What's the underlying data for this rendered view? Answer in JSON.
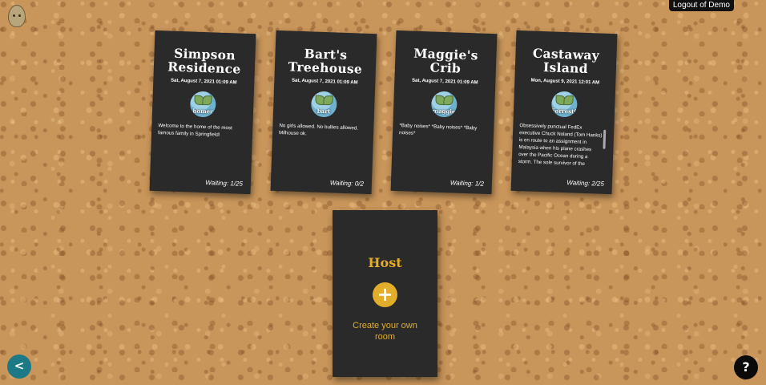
{
  "logo": {
    "icon": "potato-logo-icon"
  },
  "header": {
    "logout_label": "Logout of Demo"
  },
  "rooms": [
    {
      "title": "Simpson Residence",
      "date": "Sat, August 7, 2021 01:09 AM",
      "host": "homer",
      "description": "Welcome to the home of the most famous family in Springfield!",
      "waiting": "Waiting: 1/25"
    },
    {
      "title": "Bart's Treehouse",
      "date": "Sat, August 7, 2021 01:09 AM",
      "host": "bart",
      "description": "No girls allowed. No bullies allowed. Milhouse ok.",
      "waiting": "Waiting: 0/2"
    },
    {
      "title": "Maggie's Crib",
      "date": "Sat, August 7, 2021 01:09 AM",
      "host": "maggie",
      "description": "*Baby noises* *Baby noises* *Baby noises*",
      "waiting": "Waiting: 1/2"
    },
    {
      "title": "Castaway Island",
      "date": "Mon, August 9, 2021 12:01 AM",
      "host": "ForrestGump",
      "description": "Obsessively punctual FedEx executive Chuck Noland (Tom Hanks) is en route to an assignment in Malaysia when his plane crashes over the Pacific Ocean during a storm. The sole survivor of the",
      "waiting": "Waiting: 2/25"
    }
  ],
  "host_card": {
    "title": "Host",
    "plus_symbol": "+",
    "create_label": "Create your own room"
  },
  "nav": {
    "back_symbol": "<",
    "help_symbol": "?"
  },
  "colors": {
    "accent": "#e2ad2b",
    "card_bg": "#2a2a2a",
    "back_button": "#1c7a86"
  }
}
